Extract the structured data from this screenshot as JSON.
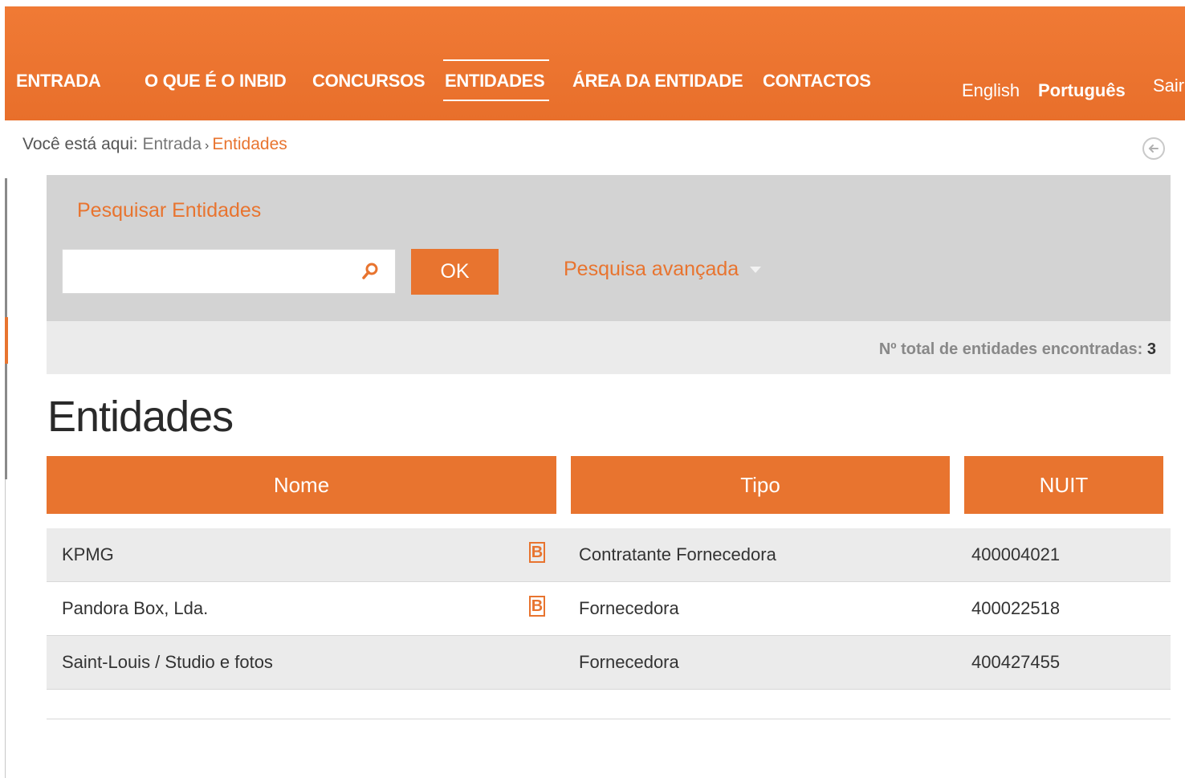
{
  "nav": {
    "items": [
      {
        "label": "ENTRADA"
      },
      {
        "label": "O QUE É O INBID"
      },
      {
        "label": "CONCURSOS"
      },
      {
        "label": "ENTIDADES"
      },
      {
        "label": "ÁREA DA ENTIDADE"
      },
      {
        "label": "CONTACTOS"
      }
    ],
    "lang_english": "English",
    "lang_portuguese": "Português",
    "logout": "Sair"
  },
  "breadcrumb": {
    "prefix": "Você está aqui:",
    "home": "Entrada",
    "separator": "›",
    "current": "Entidades"
  },
  "search": {
    "title": "Pesquisar Entidades",
    "value": "",
    "ok_label": "OK",
    "advanced_label": "Pesquisa avançada"
  },
  "results": {
    "count_label": "Nº total de entidades encontradas:",
    "count_value": "3"
  },
  "page_title": "Entidades",
  "table": {
    "headers": {
      "name": "Nome",
      "type": "Tipo",
      "nuit": "NUIT"
    },
    "rows": [
      {
        "name": "KPMG",
        "badge": "B",
        "type": "Contratante Fornecedora",
        "nuit": "400004021"
      },
      {
        "name": "Pandora Box, Lda.",
        "badge": "B",
        "type": "Fornecedora",
        "nuit": "400022518"
      },
      {
        "name": "Saint-Louis / Studio e fotos",
        "type": "Fornecedora",
        "nuit": "400427455"
      }
    ]
  },
  "colors": {
    "accent": "#e8742f",
    "panel": "#d3d3d3",
    "row_shade": "#ebebeb"
  },
  "icons": [
    "search-icon",
    "back-arrow-icon",
    "chevron-down-icon",
    "b-badge-icon"
  ]
}
